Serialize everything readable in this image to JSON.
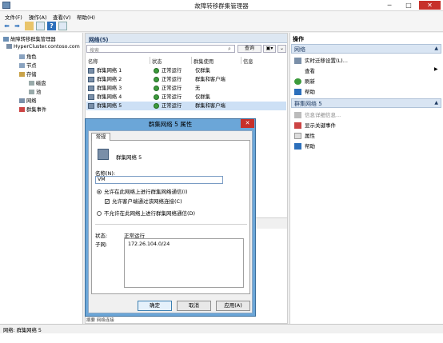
{
  "window": {
    "title": "故障转移群集管理器",
    "minimize": "─",
    "maximize": "□",
    "close": "✕"
  },
  "menu": [
    "文件(F)",
    "操作(A)",
    "查看(V)",
    "帮助(H)"
  ],
  "tree": [
    {
      "label": "故障转移群集管理器",
      "indent": 0
    },
    {
      "label": "HyperCluster.contoso.com",
      "indent": 1
    },
    {
      "label": "角色",
      "indent": 2
    },
    {
      "label": "节点",
      "indent": 2
    },
    {
      "label": "存储",
      "indent": 2
    },
    {
      "label": "磁盘",
      "indent": 3
    },
    {
      "label": "池",
      "indent": 3
    },
    {
      "label": "网络",
      "indent": 2
    },
    {
      "label": "群集事件",
      "indent": 2
    }
  ],
  "center": {
    "title": "网络(5)",
    "filter_placeholder": "搜索",
    "query_label": "查询",
    "columns": [
      "名称",
      "状态",
      "群集使用",
      "信息"
    ],
    "rows": [
      {
        "name": "群集网络 1",
        "status": "正常运行",
        "usage": "仅群集",
        "info": ""
      },
      {
        "name": "群集网络 2",
        "status": "正常运行",
        "usage": "群集和客户端",
        "info": ""
      },
      {
        "name": "群集网络 3",
        "status": "正常运行",
        "usage": "无",
        "info": ""
      },
      {
        "name": "群集网络 4",
        "status": "正常运行",
        "usage": "仅群集",
        "info": ""
      },
      {
        "name": "群集网络 5",
        "status": "正常运行",
        "usage": "群集和客户端",
        "info": ""
      }
    ],
    "bottom_tabs": "摘要  网络连接"
  },
  "actions": {
    "header": "操作",
    "group1": "网络",
    "group1_items": [
      "实时迁移设置(L)...",
      "查看",
      "刷新",
      "帮助"
    ],
    "group2": "群集网络 5",
    "group2_items": [
      "信息详细信息...",
      "显示关键事件",
      "属性",
      "帮助"
    ]
  },
  "status": "网络: 群集网络 5",
  "dialog": {
    "title": "群集网络 5 属性",
    "tab": "常规",
    "network_name": "群集网络 5",
    "name_label": "名称(N):",
    "name_value": "VM",
    "radio1": "允许在此网络上进行群集网络通信(I)",
    "check1": "允许客户端通过该网络连接(C)",
    "radio2": "不允许在此网络上进行群集网络通信(D)",
    "status_label": "状态:",
    "status_value": "正常运行",
    "subnet_label": "子网:",
    "subnet_value": "172.26.104.0/24",
    "ok": "确定",
    "cancel": "取消",
    "apply": "应用(A)"
  }
}
